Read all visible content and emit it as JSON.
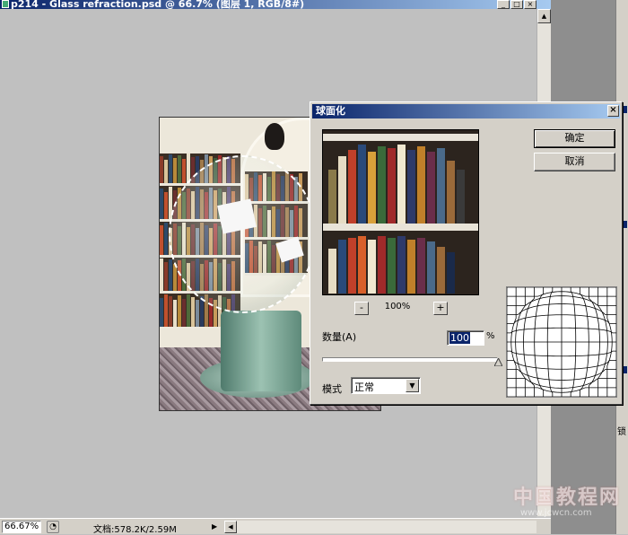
{
  "document": {
    "title": "p214 - Glass refraction.psd @ 66.7% (图层 1, RGB/8#)",
    "minimize": "_",
    "maximize": "□",
    "close": "×"
  },
  "dialog": {
    "title": "球面化",
    "close": "×",
    "ok_label": "确定",
    "cancel_label": "取消",
    "zoom_out": "-",
    "zoom_in": "+",
    "zoom_level": "100%",
    "amount_label": "数量(A)",
    "amount_value": "100",
    "amount_unit": "%",
    "amount_fraction": 1.0,
    "mode_label": "模式",
    "mode_value": "正常"
  },
  "status_bar": {
    "zoom": "66.67%",
    "doc_info": "文档:578.2K/2.59M"
  },
  "watermark": {
    "text": "中国教程网",
    "url": "www.jcwcn.com"
  },
  "icons": {
    "nav": "navigator-icon",
    "arrow": "triangle-right-icon"
  }
}
